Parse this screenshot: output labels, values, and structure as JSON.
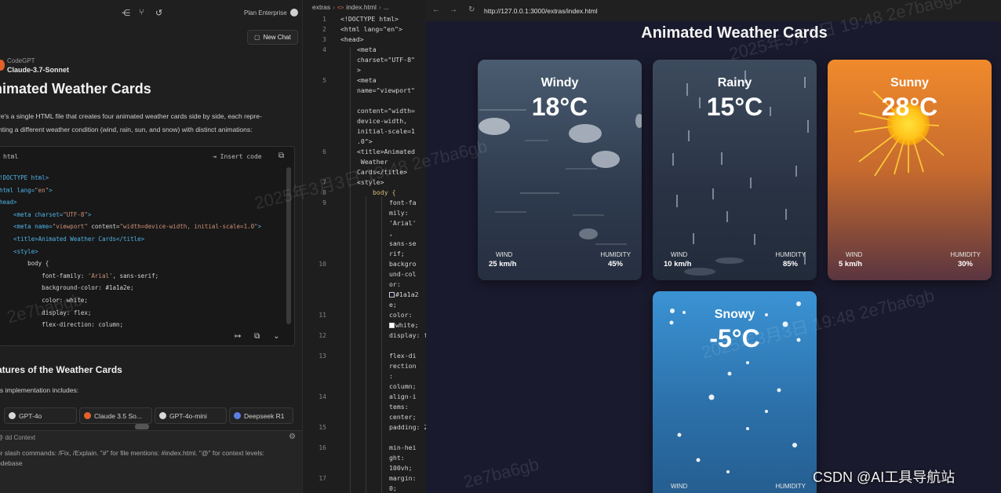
{
  "chat": {
    "plan_label": "Plan Enterprise",
    "new_chat_label": "New Chat",
    "provider": "CodeGPT",
    "model": "Claude-3.7-Sonnet",
    "title": "nimated Weather Cards",
    "description_line1": "re's a single HTML file that creates four animated weather cards side by side, each repre-",
    "description_line2": "nting a different weather condition (wind, rain, sun, and snow) with distinct animations:",
    "code_lang": "html",
    "insert_code_label": "Insert code",
    "code_lines": [
      "!DOCTYPE html>",
      "html lang=\"en\">",
      "head>",
      "    <meta charset=\"UTF-8\">",
      "    <meta name=\"viewport\" content=\"width=device-width, initial-scale=1.0\">",
      "    <title>Animated Weather Cards</title>",
      "    <style>",
      "        body {",
      "            font-family: 'Arial', sans-serif;",
      "            background-color: #1a1a2e;",
      "            color: white;",
      "            display: flex;",
      "            flex-direction: column;"
    ],
    "features_title": "atures of the Weather Cards",
    "features_intro": "is implementation includes:",
    "model_chips": [
      "GPT-4o",
      "Claude 3.5 So...",
      "GPT-4o-mini",
      "Deepseek R1"
    ],
    "add_context_label": "dd Context",
    "context_help_line1": "or slash commands: /Fix, /Explain. \"#\" for file mentions: #index.html. \"@\" for context levels:",
    "context_help_line2": "odebase"
  },
  "editor": {
    "breadcrumb": [
      "extras",
      "index.html",
      "..."
    ],
    "gutter": [
      "1",
      "2",
      "3",
      "4",
      "5",
      "6",
      "7",
      "8",
      "9",
      "10",
      "11",
      "12",
      "13",
      "14",
      "15",
      "16",
      "17"
    ],
    "code": {
      "l1": "<!DOCTYPE html>",
      "l2": "<html lang=\"en\">",
      "l3": "<head>",
      "l4a": "<meta",
      "l4b": "charset=\"UTF-8\"",
      "l4c": ">",
      "l5a": "<meta",
      "l5b": "name=\"viewport\"",
      "l5c": "content=\"width=",
      "l5d": "device-width,",
      "l5e": "initial-scale=1",
      "l5f": ".0\">",
      "l6a": "<title>Animated",
      "l6b": " Weather",
      "l6c": "Cards</title>",
      "l7": "<style>",
      "l8": "body {",
      "l9a": "font-fa",
      "l9b": "mily:",
      "l9c": "'Arial'",
      "l9d": ",",
      "l9e": "sans-se",
      "l9f": "rif;",
      "l10a": "backgro",
      "l10b": "und-col",
      "l10c": "or:",
      "l10d": "#1a1a2",
      "l10e": "e;",
      "l11a": "color:",
      "l11b": "white;",
      "l12": "display: flex;",
      "l13a": "flex-di",
      "l13b": "rection",
      "l13c": ":",
      "l13d": "column;",
      "l14a": "align-i",
      "l14b": "tems:",
      "l14c": "center;",
      "l15": "padding: 20px;",
      "l16a": "min-hei",
      "l16b": "ght:",
      "l16c": "100vh;",
      "l17a": "margin:",
      "l17b": "0;"
    }
  },
  "browser": {
    "url": "http://127.0.0.1:3000/extras/index.html",
    "page_title": "Animated Weather Cards",
    "cards": [
      {
        "condition": "Windy",
        "temp": "18°C",
        "wind_label": "WIND",
        "wind_value": "25 km/h",
        "humidity_label": "HUMIDITY",
        "humidity_value": "45%"
      },
      {
        "condition": "Rainy",
        "temp": "15°C",
        "wind_label": "WIND",
        "wind_value": "10 km/h",
        "humidity_label": "HUMIDITY",
        "humidity_value": "85%"
      },
      {
        "condition": "Sunny",
        "temp": "28°C",
        "wind_label": "WIND",
        "wind_value": "5 km/h",
        "humidity_label": "HUMIDITY",
        "humidity_value": "30%"
      },
      {
        "condition": "Snowy",
        "temp": "-5°C",
        "wind_label": "WIND",
        "wind_value": "",
        "humidity_label": "HUMIDITY",
        "humidity_value": ""
      }
    ]
  },
  "watermarks": {
    "timestamp": "2025年3月3日 19:48 2e7ba6gb",
    "hash": "2e7ba6gb",
    "csdn": "CSDN @AI工具导航站"
  },
  "colors": {
    "page_bg": "#1a1a2e",
    "sunny": "#f08a2c",
    "snowy": "#3b93d4",
    "string": "#ce9178",
    "tag": "#4fb3e6"
  }
}
